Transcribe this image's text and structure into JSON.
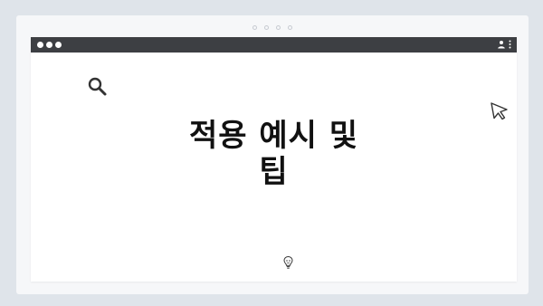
{
  "pager": {
    "dots": 4
  },
  "window": {
    "titlebar_dots": 3,
    "titlebar_icons": [
      "user-icon",
      "kebab-icon"
    ]
  },
  "content": {
    "headline_line1": "적용 예시 및",
    "headline_line2": "팁",
    "icons": [
      "search-icon",
      "cursor-icon",
      "lightbulb-icon"
    ]
  },
  "colors": {
    "background": "#dfe4ea",
    "frame": "#f6f7f9",
    "titlebar": "#3d3f43",
    "text": "#111111"
  }
}
